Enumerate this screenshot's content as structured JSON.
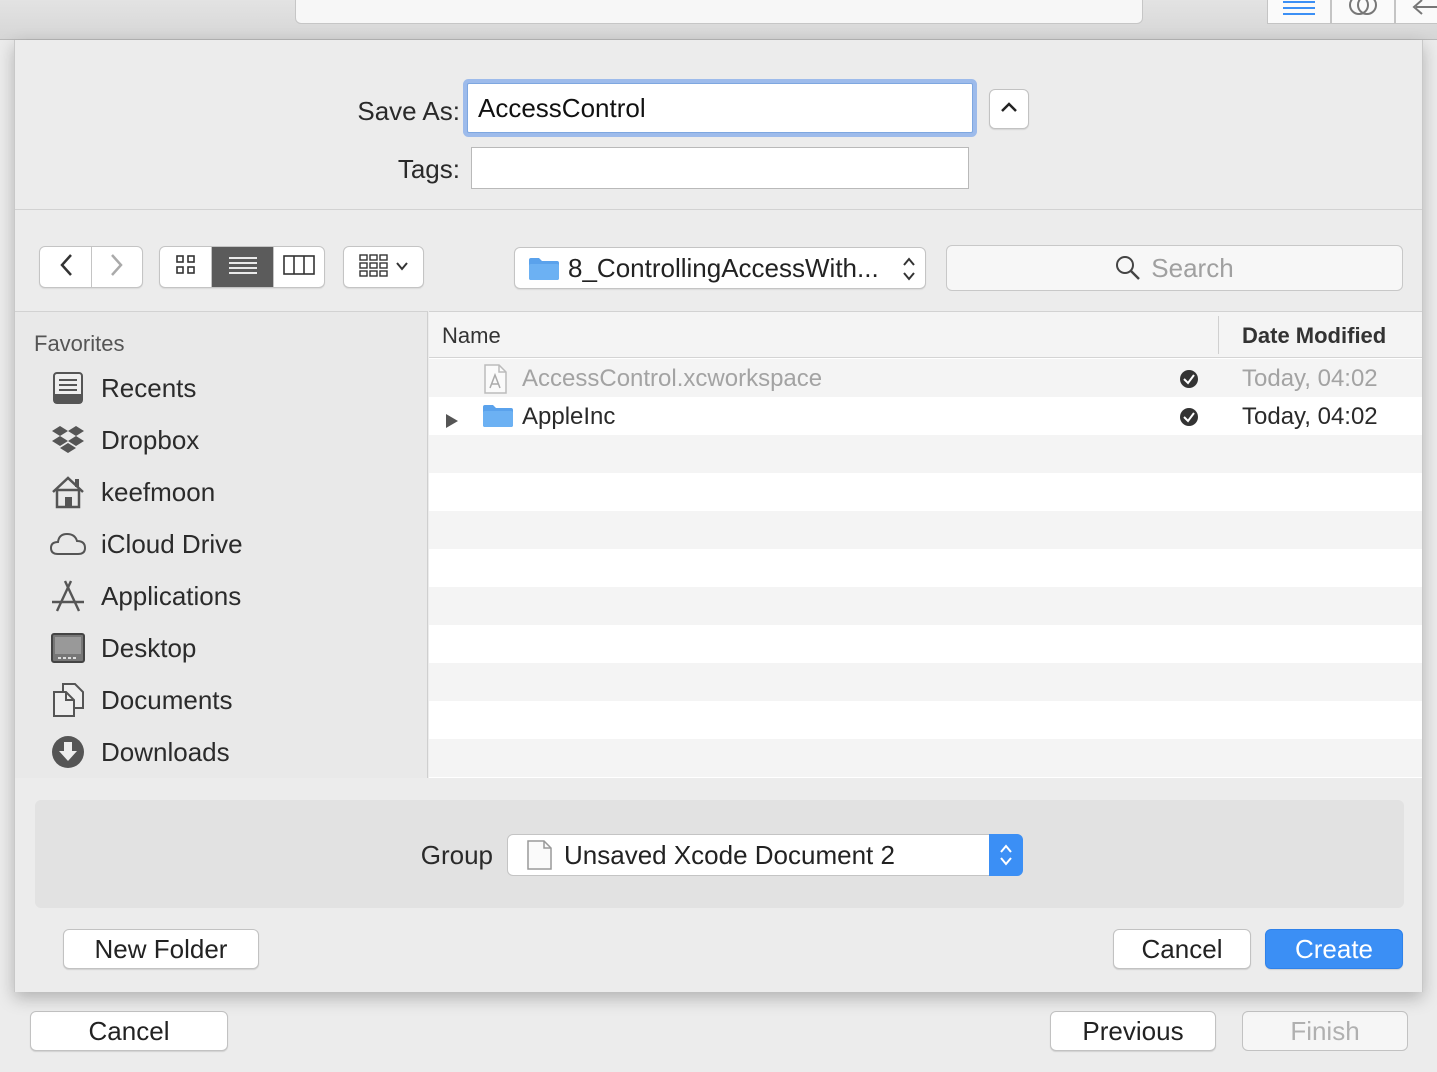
{
  "save_as": {
    "label": "Save As:",
    "value": "AccessControl",
    "tags_label": "Tags:",
    "tags_value": ""
  },
  "toolbar": {
    "location": "8_ControllingAccessWith...",
    "search_placeholder": "Search"
  },
  "sidebar": {
    "heading": "Favorites",
    "items": [
      {
        "label": "Recents",
        "icon": "recents-icon"
      },
      {
        "label": "Dropbox",
        "icon": "dropbox-icon"
      },
      {
        "label": "keefmoon",
        "icon": "home-icon"
      },
      {
        "label": "iCloud Drive",
        "icon": "cloud-icon"
      },
      {
        "label": "Applications",
        "icon": "applications-icon"
      },
      {
        "label": "Desktop",
        "icon": "desktop-icon"
      },
      {
        "label": "Documents",
        "icon": "documents-icon"
      },
      {
        "label": "Downloads",
        "icon": "downloads-icon"
      }
    ]
  },
  "filelist": {
    "col_name": "Name",
    "col_date": "Date Modified",
    "rows": [
      {
        "name": "AccessControl.xcworkspace",
        "date": "Today, 04:02"
      },
      {
        "name": "AppleInc",
        "date": "Today, 04:02"
      }
    ]
  },
  "accessory": {
    "group_label": "Group",
    "group_value": "Unsaved Xcode Document 2"
  },
  "buttons": {
    "new_folder": "New Folder",
    "cancel": "Cancel",
    "create": "Create"
  },
  "wizard": {
    "cancel": "Cancel",
    "previous": "Previous",
    "finish": "Finish"
  },
  "colors": {
    "accent": "#3b8ff5",
    "focus_ring": "#9dbbeb"
  }
}
